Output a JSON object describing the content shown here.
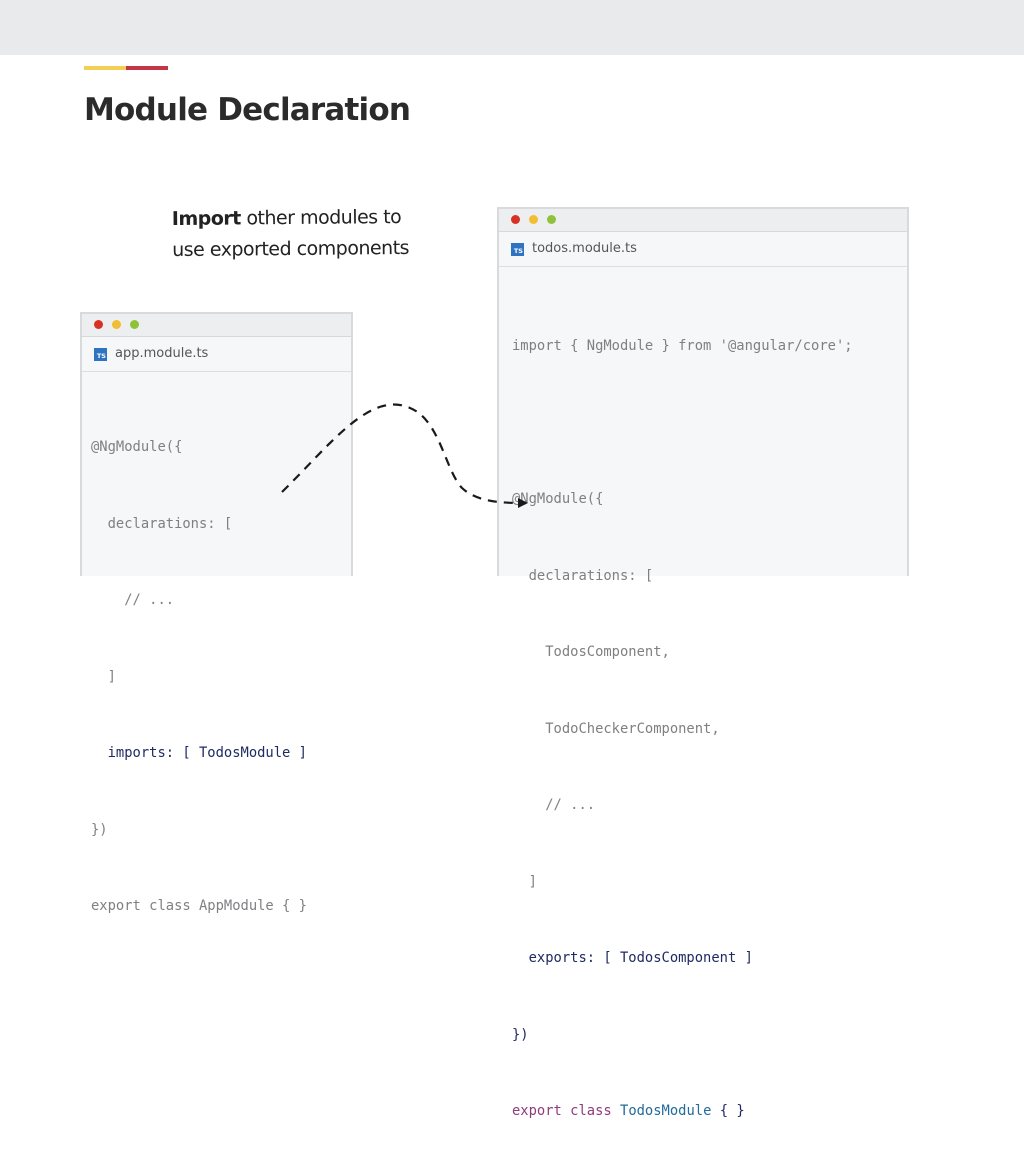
{
  "slide": {
    "title": "Module Declaration",
    "accent_colors": [
      "#f2cf55",
      "#c43645"
    ]
  },
  "note": {
    "bold": "Import",
    "rest_line1": " other modules to",
    "line2": "use exported components"
  },
  "app_window": {
    "filename": "app.module.ts",
    "file_icon": "TS",
    "lines": [
      "@NgModule({",
      "  declarations: [",
      "    // ...",
      "  ]",
      "  imports: [ TodosModule ]",
      "})",
      "export class AppModule { }"
    ]
  },
  "todos_window": {
    "filename": "todos.module.ts",
    "file_icon": "TS",
    "lines": [
      "import { NgModule } from '@angular/core';",
      "",
      "@NgModule({",
      "  declarations: [",
      "    TodosComponent,",
      "    TodoCheckerComponent,",
      "    // ...",
      "  ]",
      "  exports: [ TodosComponent ]",
      "})",
      "export class TodosModule { }"
    ]
  },
  "colors": {
    "code_dim": "#7f8082",
    "code_highlight": "#1f2a63",
    "keyword": "#8f3b7a",
    "type": "#226b9a",
    "ts_icon": "#2f74c0"
  }
}
